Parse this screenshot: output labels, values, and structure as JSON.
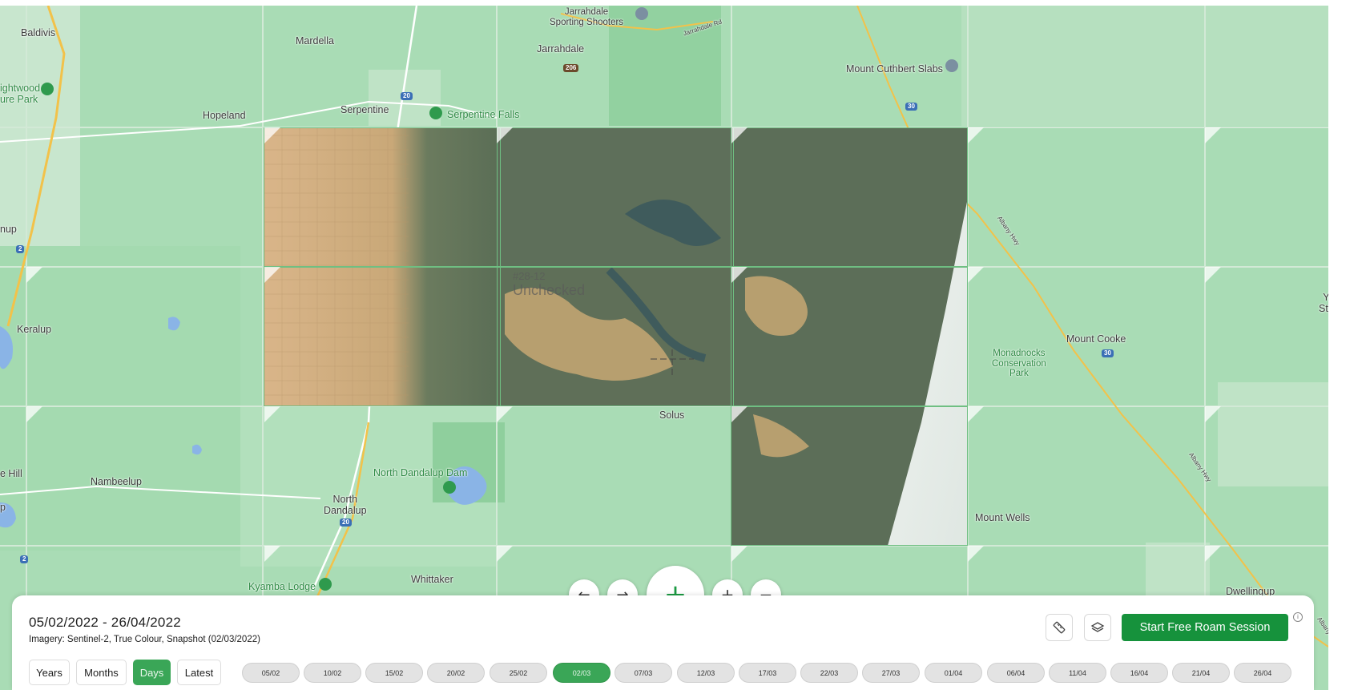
{
  "map": {
    "places": [
      {
        "id": "baldivis",
        "label": "Baldivis"
      },
      {
        "id": "mardella",
        "label": "Mardella"
      },
      {
        "id": "jarrahdale",
        "label": "Jarrahdale"
      },
      {
        "id": "jarrahdale-sporting",
        "label": "Jarrahdale\nSporting Shooters"
      },
      {
        "id": "mount-cuthbert",
        "label": "Mount Cuthbert Slabs"
      },
      {
        "id": "wellard",
        "label": "ightwood\nure Park"
      },
      {
        "id": "hopeland",
        "label": "Hopeland"
      },
      {
        "id": "serpentine",
        "label": "Serpentine"
      },
      {
        "id": "serpentine-falls",
        "label": "Serpentine Falls"
      },
      {
        "id": "nup",
        "label": "nup"
      },
      {
        "id": "keralup",
        "label": "Keralup"
      },
      {
        "id": "mount-cooke",
        "label": "Mount Cooke"
      },
      {
        "id": "monadnocks",
        "label": "Monadnocks\nConservation\nPark"
      },
      {
        "id": "solus",
        "label": "Solus"
      },
      {
        "id": "e-hill",
        "label": "e Hill"
      },
      {
        "id": "nambeelup",
        "label": "Nambeelup"
      },
      {
        "id": "north-dandalup-dam",
        "label": "North Dandalup Dam"
      },
      {
        "id": "north-dandalup",
        "label": "North\nDandalup"
      },
      {
        "id": "mount-wells",
        "label": "Mount Wells"
      },
      {
        "id": "kyamba",
        "label": "Kyamba Lodge"
      },
      {
        "id": "whittaker",
        "label": "Whittaker"
      },
      {
        "id": "dwellingup",
        "label": "Dwellingup"
      },
      {
        "id": "ys",
        "label": "Y\nSta"
      },
      {
        "id": "p",
        "label": "p"
      },
      {
        "id": "jarrahdale-rd",
        "label": "Jarrahdale Rd"
      },
      {
        "id": "albany-hwy-1",
        "label": "Albany Hwy"
      },
      {
        "id": "albany-hwy-2",
        "label": "Albany Hwy"
      },
      {
        "id": "albany-hwy-3",
        "label": "Albany"
      }
    ],
    "shields": [
      {
        "id": "s206",
        "label": "206",
        "kind": "brown"
      },
      {
        "id": "s20a",
        "label": "20",
        "kind": "blue"
      },
      {
        "id": "s20b",
        "label": "20",
        "kind": "blue"
      },
      {
        "id": "s30a",
        "label": "30",
        "kind": "blue"
      },
      {
        "id": "s30b",
        "label": "30",
        "kind": "blue"
      },
      {
        "id": "s2a",
        "label": "2",
        "kind": "blue"
      },
      {
        "id": "s2b",
        "label": "2",
        "kind": "blue"
      }
    ],
    "tile_label": {
      "number": "#28-12",
      "status": "Unchecked"
    },
    "colors": {
      "base": "#a9dcb5",
      "grid": "#d2e9d6",
      "tile_border": "#6fbf82",
      "highway": "#f2c24a",
      "accent": "#16923c"
    }
  },
  "controls": {
    "prev_icon": "arrow-left-icon",
    "next_icon": "arrow-right-icon",
    "add_icon": "plus-icon",
    "zoom_in_icon": "plus-icon",
    "zoom_out_icon": "minus-icon"
  },
  "panel": {
    "date_range": "05/02/2022 - 26/04/2022",
    "imagery": "Imagery: Sentinel-2, True Colour, Snapshot (02/03/2022)",
    "granularity": [
      {
        "label": "Years",
        "active": false
      },
      {
        "label": "Months",
        "active": false
      },
      {
        "label": "Days",
        "active": true
      },
      {
        "label": "Latest",
        "active": false
      }
    ],
    "dates": [
      {
        "label": "05/02",
        "active": false
      },
      {
        "label": "10/02",
        "active": false
      },
      {
        "label": "15/02",
        "active": false
      },
      {
        "label": "20/02",
        "active": false
      },
      {
        "label": "25/02",
        "active": false
      },
      {
        "label": "02/03",
        "active": true
      },
      {
        "label": "07/03",
        "active": false
      },
      {
        "label": "12/03",
        "active": false
      },
      {
        "label": "17/03",
        "active": false
      },
      {
        "label": "22/03",
        "active": false
      },
      {
        "label": "27/03",
        "active": false
      },
      {
        "label": "01/04",
        "active": false
      },
      {
        "label": "06/04",
        "active": false
      },
      {
        "label": "11/04",
        "active": false
      },
      {
        "label": "16/04",
        "active": false
      },
      {
        "label": "21/04",
        "active": false
      },
      {
        "label": "26/04",
        "active": false
      }
    ],
    "ruler_icon": "ruler-icon",
    "layers_icon": "layers-icon",
    "roam_button": "Start Free Roam Session",
    "info_glyph": "i"
  }
}
